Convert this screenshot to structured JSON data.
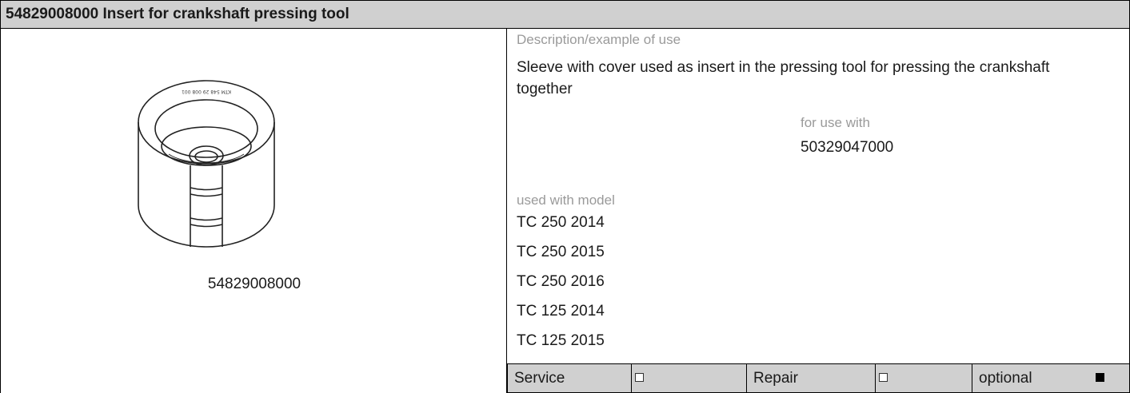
{
  "title": "54829008000 Insert for crankshaft pressing tool",
  "image_caption": "54829008000",
  "image_icon": "sleeve-insert-icon",
  "image_engraving": "KTM 548 29 008 001",
  "description_label": "Description/example of use",
  "description_text": "Sleeve with cover used as insert in the pressing tool for pressing the crankshaft together",
  "for_use_with_label": "for use with",
  "for_use_with_value": "50329047000",
  "used_with_model_label": "used with model",
  "models": [
    "TC 250 2014",
    "TC 250 2015",
    "TC 250 2016",
    "TC 125 2014",
    "TC 125 2015"
  ],
  "categories": [
    {
      "label": "Service",
      "checked": false
    },
    {
      "label": "Repair",
      "checked": false
    },
    {
      "label": "optional",
      "checked": true
    }
  ],
  "colors": {
    "header_bg": "#d0d0d0",
    "label_gray": "#9a9a9a",
    "border": "#000000"
  }
}
